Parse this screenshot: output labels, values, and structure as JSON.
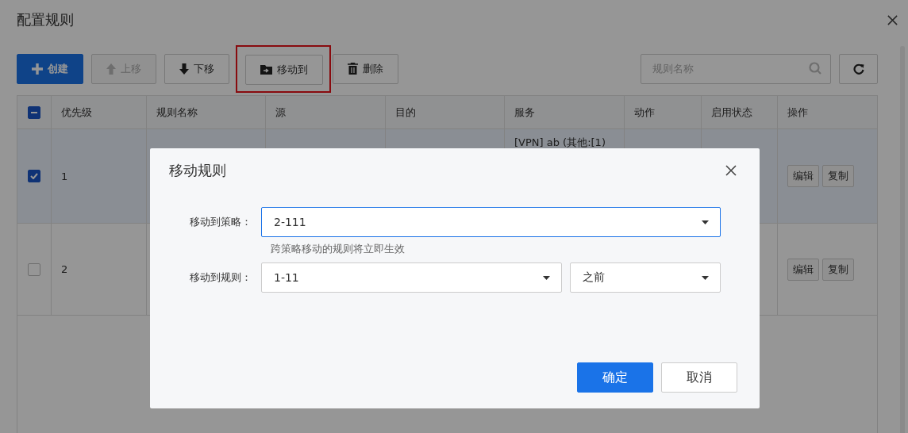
{
  "page": {
    "title": "配置规则"
  },
  "toolbar": [
    {
      "kind": "create",
      "label": "创建",
      "disabled": false,
      "highlighted": false
    },
    {
      "kind": "up",
      "label": "上移",
      "disabled": true,
      "highlighted": false
    },
    {
      "kind": "down",
      "label": "下移",
      "disabled": false,
      "highlighted": false
    },
    {
      "kind": "move",
      "label": "移动到",
      "disabled": false,
      "highlighted": true
    },
    {
      "kind": "delete",
      "label": "删除",
      "disabled": false,
      "highlighted": false
    }
  ],
  "search": {
    "placeholder": "规则名称"
  },
  "table": {
    "select_all": {
      "checked": true,
      "indeterminate": true
    },
    "columns": [
      "优先级",
      "规则名称",
      "源",
      "目的",
      "服务",
      "动作",
      "启用状态",
      "操作"
    ],
    "rows": [
      {
        "checked": true,
        "priority": "1",
        "service": "[VPN] ab (其他:[1)",
        "actions": [
          "编辑",
          "复制"
        ]
      },
      {
        "checked": false,
        "priority": "2",
        "actions": [
          "编辑",
          "复制"
        ]
      }
    ]
  },
  "dialog": {
    "title": "移动规则",
    "fields": [
      {
        "label": "移动到策略：",
        "value": "2-111",
        "focused": true,
        "hint": "跨策略移动的规则将立即生效"
      },
      {
        "label": "移动到规则：",
        "value": "1-11",
        "focused": false,
        "position": "之前"
      }
    ],
    "buttons": [
      {
        "kind": "primary",
        "label": "确定"
      },
      {
        "kind": "default",
        "label": "取消"
      }
    ]
  }
}
